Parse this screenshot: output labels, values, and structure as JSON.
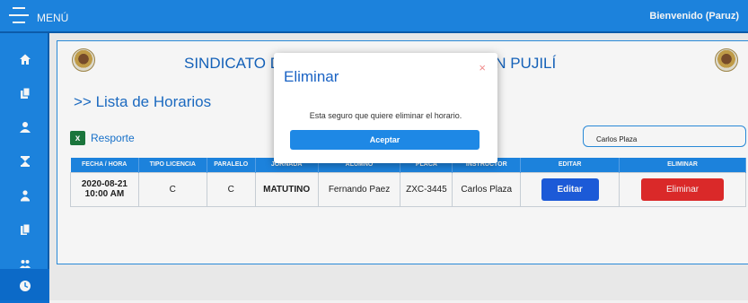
{
  "topbar": {
    "menu_label": "MENÚ",
    "welcome": "Bienvenido (Paruz)"
  },
  "header": {
    "org_title_left": "SINDICATO DE C",
    "org_title_right": "ÓN PUJILÍ"
  },
  "page": {
    "title": ">> Lista de Horarios",
    "report_label": "Resporte",
    "search_value": "Carlos Plaza"
  },
  "table": {
    "headers": [
      "FECHA / HORA",
      "TIPO LICENCIA",
      "PARALELO",
      "JORNADA",
      "ALUMNO",
      "PLACA",
      "INSTRUCTOR",
      "EDITAR",
      "ELIMINAR"
    ],
    "rows": [
      {
        "fecha": "2020-08-21",
        "hora": "10:00 AM",
        "tipo": "C",
        "paralelo": "C",
        "jornada": "MATUTINO",
        "alumno": "Fernando Paez",
        "placa": "ZXC-3445",
        "instructor": "Carlos Plaza",
        "editar": "Editar",
        "eliminar": "Eliminar"
      }
    ]
  },
  "modal": {
    "title": "Eliminar",
    "close": "×",
    "message": "Esta seguro que quiere eliminar el horario.",
    "accept": "Aceptar"
  },
  "sidebar": {
    "icons": [
      "home-icon",
      "copy-icon",
      "user-icon",
      "hourglass-icon",
      "users-icon",
      "documents-icon",
      "user-group-icon",
      "clock-icon"
    ]
  },
  "colors": {
    "primary": "#1e88e5",
    "danger": "#e32b2b",
    "edit": "#1e5ee0"
  }
}
